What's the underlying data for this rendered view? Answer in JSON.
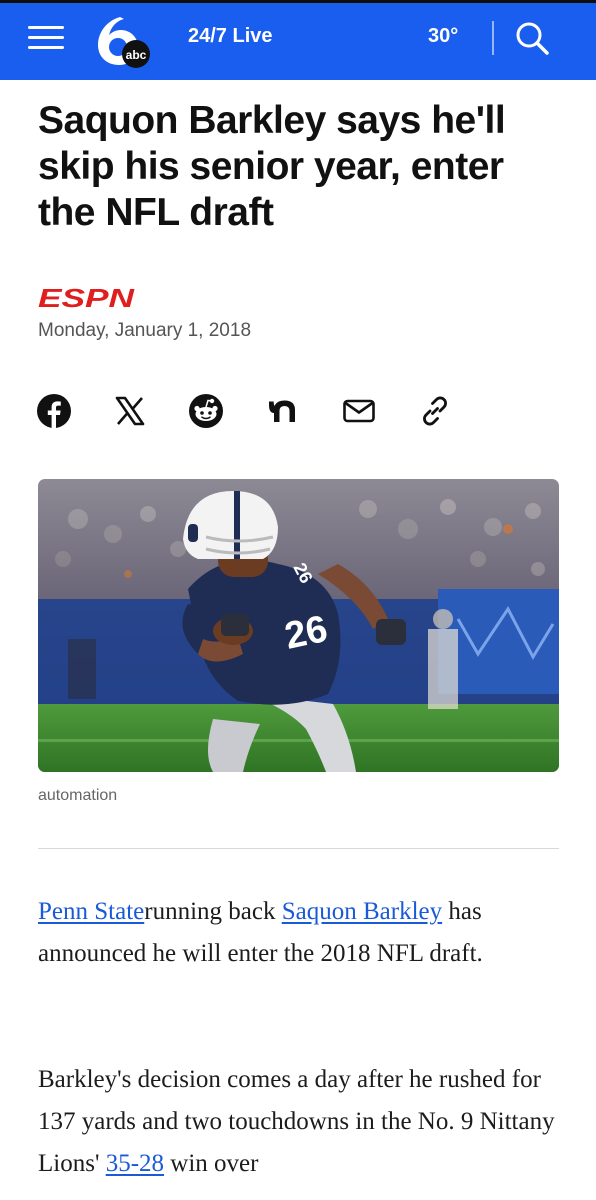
{
  "nav": {
    "live_label": "24/7 Live",
    "temperature": "30°",
    "brand_color": "#1a5ef0",
    "logo_text": "abc"
  },
  "article": {
    "headline": "Saquon Barkley says he'll skip his senior year, enter the NFL draft",
    "source": "ESPN",
    "source_color": "#e01e1e",
    "date": "Monday, January 1, 2018",
    "share_icons": [
      "facebook-icon",
      "x-icon",
      "reddit-icon",
      "nextdoor-icon",
      "email-icon",
      "link-icon"
    ],
    "image_caption": "automation",
    "jersey_number": "26"
  },
  "body": {
    "p1": {
      "link1": "Penn State",
      "t1": "running back ",
      "link2": "Saquon Barkley",
      "t2": " has announced he will enter the 2018 NFL draft."
    },
    "p2": {
      "t1": "Barkley's decision comes a day after he rushed for 137 yards and two touchdowns in the No. 9 Nittany Lions' ",
      "link1": "35-28",
      "t2": " win over"
    }
  }
}
